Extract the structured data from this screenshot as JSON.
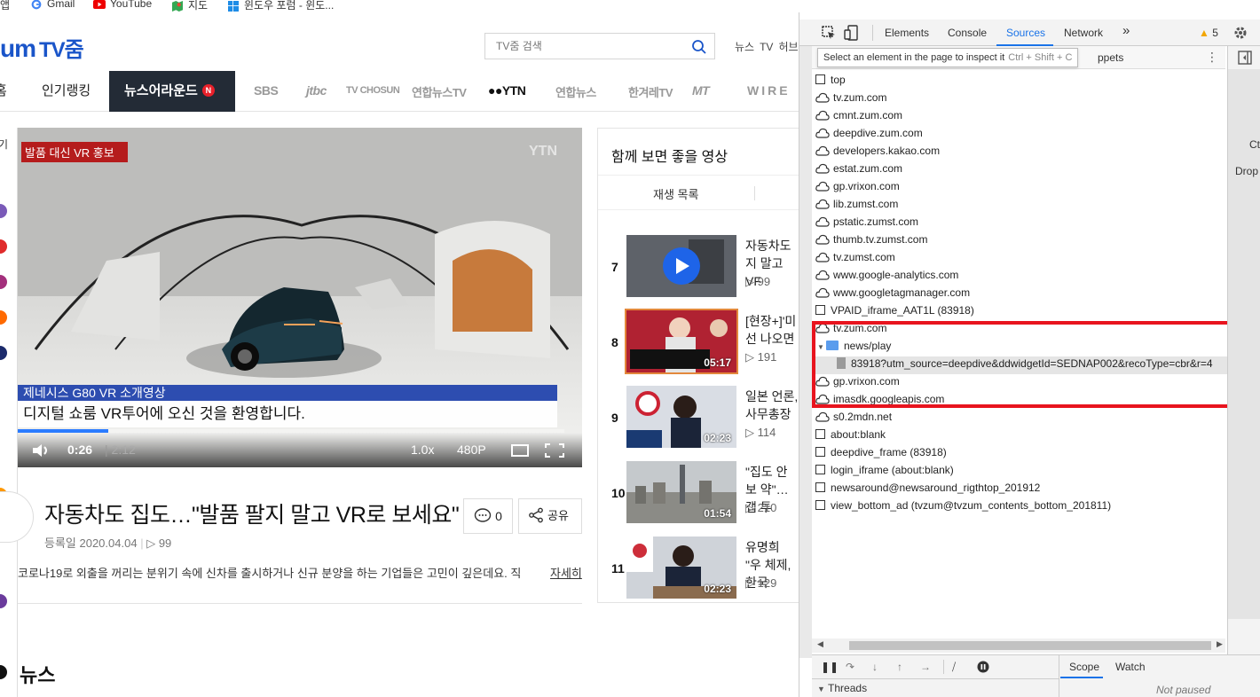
{
  "bookmarks": [
    {
      "label": "앱",
      "icon": "apps-icon"
    },
    {
      "label": "Gmail",
      "icon": "google-icon"
    },
    {
      "label": "YouTube",
      "icon": "youtube-icon"
    },
    {
      "label": "지도",
      "icon": "maps-icon"
    },
    {
      "label": "윈도우 포럼 - 윈도...",
      "icon": "windows-icon"
    }
  ],
  "site": {
    "logo": "um",
    "logo_suffix": "TV줌",
    "search_placeholder": "TV줌 검색",
    "top_links": [
      "뉴스",
      "TV",
      "허브"
    ]
  },
  "nav": {
    "items": [
      "홈",
      "인기랭킹",
      "뉴스어라운드"
    ],
    "news_badge": "N",
    "channels": [
      "SBS",
      "jtbc",
      "TV CHOSUN",
      "연합뉴스TV",
      "YTN",
      "연합뉴스",
      "한겨레TV",
      "MT",
      "WIRE"
    ]
  },
  "video": {
    "tag": "발품 대신 VR 홍보",
    "watermark": "YTN",
    "caption_top": "제네시스 G80 VR 소개영상",
    "caption_main": "디지털 쇼룸 VR투어에 오신 것을 환영합니다.",
    "current_time": "0:26",
    "duration": "2:12",
    "speed": "1.0x",
    "quality": "480P",
    "progress": 0.165,
    "accent": "#2a7bff"
  },
  "article": {
    "title": "자동차도 집도…\"발품 팔지 말고 VR로 보세요\"",
    "date": "등록일 2020.04.04",
    "views": "▷ 99",
    "comments": "0",
    "share": "공유",
    "description": "코로나19로 외출을 꺼리는 분위기 속에 신차를 출시하거나 신규 분양을 하는 기업들은 고민이 깊은데요. 직",
    "more": "자세히"
  },
  "news_heading": "뉴스",
  "side_label": "기",
  "related": {
    "title": "함께 보면 좋을 영상",
    "tab": "재생 목록",
    "items": [
      {
        "num": "7",
        "title": "자동차도 지 말고 VF",
        "views": "▷ 99",
        "duration": ""
      },
      {
        "num": "8",
        "title": "[현장+]'미 선 나오면",
        "views": "▷ 191",
        "duration": "05:17"
      },
      {
        "num": "9",
        "title": "일본 언론, 사무총장",
        "views": "▷ 114",
        "duration": "02:23"
      },
      {
        "num": "10",
        "title": "\"집도 안 보 약\"…갭 투",
        "views": "▷ 210",
        "duration": "01:54"
      },
      {
        "num": "11",
        "title": "유명희 \"우 체제, 한국",
        "views": "▷ 129",
        "duration": "02:23"
      }
    ]
  },
  "devtools": {
    "tabs": [
      "Elements",
      "Console",
      "Sources",
      "Network",
      "»"
    ],
    "active_tab": "Sources",
    "warnings": "5",
    "tooltip": "Select an element in the page to inspect it",
    "tooltip_shortcut": "Ctrl + Shift + C",
    "snippets": "ppets",
    "tree": [
      {
        "depth": 0,
        "kind": "frame",
        "label": "top"
      },
      {
        "depth": 0,
        "kind": "cloud",
        "label": "tv.zum.com"
      },
      {
        "depth": 0,
        "kind": "cloud",
        "label": "cmnt.zum.com"
      },
      {
        "depth": 0,
        "kind": "cloud",
        "label": "deepdive.zum.com"
      },
      {
        "depth": 0,
        "kind": "cloud",
        "label": "developers.kakao.com"
      },
      {
        "depth": 0,
        "kind": "cloud",
        "label": "estat.zum.com"
      },
      {
        "depth": 0,
        "kind": "cloud",
        "label": "gp.vrixon.com"
      },
      {
        "depth": 0,
        "kind": "cloud",
        "label": "lib.zumst.com"
      },
      {
        "depth": 0,
        "kind": "cloud",
        "label": "pstatic.zumst.com"
      },
      {
        "depth": 0,
        "kind": "cloud",
        "label": "thumb.tv.zumst.com"
      },
      {
        "depth": 0,
        "kind": "cloud",
        "label": "tv.zumst.com"
      },
      {
        "depth": 0,
        "kind": "cloud",
        "label": "www.google-analytics.com"
      },
      {
        "depth": 0,
        "kind": "cloud",
        "label": "www.googletagmanager.com"
      },
      {
        "depth": 0,
        "kind": "frame",
        "label": "VPAID_iframe_AAT1L (83918)"
      },
      {
        "depth": 0,
        "kind": "cloud",
        "label": "tv.zum.com",
        "expanded": true
      },
      {
        "depth": 1,
        "kind": "folder",
        "label": "news/play",
        "expanded": true
      },
      {
        "depth": 2,
        "kind": "file",
        "label": "83918?utm_source=deepdive&ddwidgetId=SEDNAP002&recoType=cbr&r=4"
      },
      {
        "depth": 0,
        "kind": "cloud",
        "label": "gp.vrixon.com",
        "collapsed": true
      },
      {
        "depth": 0,
        "kind": "cloud",
        "label": "imasdk.googleapis.com",
        "collapsed": true
      },
      {
        "depth": 0,
        "kind": "cloud",
        "label": "s0.2mdn.net",
        "collapsed": true
      },
      {
        "depth": 0,
        "kind": "frame",
        "label": "about:blank"
      },
      {
        "depth": 0,
        "kind": "frame",
        "label": "deepdive_frame (83918)"
      },
      {
        "depth": 0,
        "kind": "frame",
        "label": "login_iframe (about:blank)"
      },
      {
        "depth": 0,
        "kind": "frame",
        "label": "newsaround@newsaround_rigthtop_201912"
      },
      {
        "depth": 0,
        "kind": "frame",
        "label": "view_bottom_ad (tvzum@tvzum_contents_bottom_201811)"
      }
    ],
    "right_panel": [
      "Ct",
      "Drop"
    ],
    "scope": "Scope",
    "watch": "Watch",
    "threads": "Threads",
    "not_paused": "Not paused",
    "highlight_color": "#e8141e"
  }
}
